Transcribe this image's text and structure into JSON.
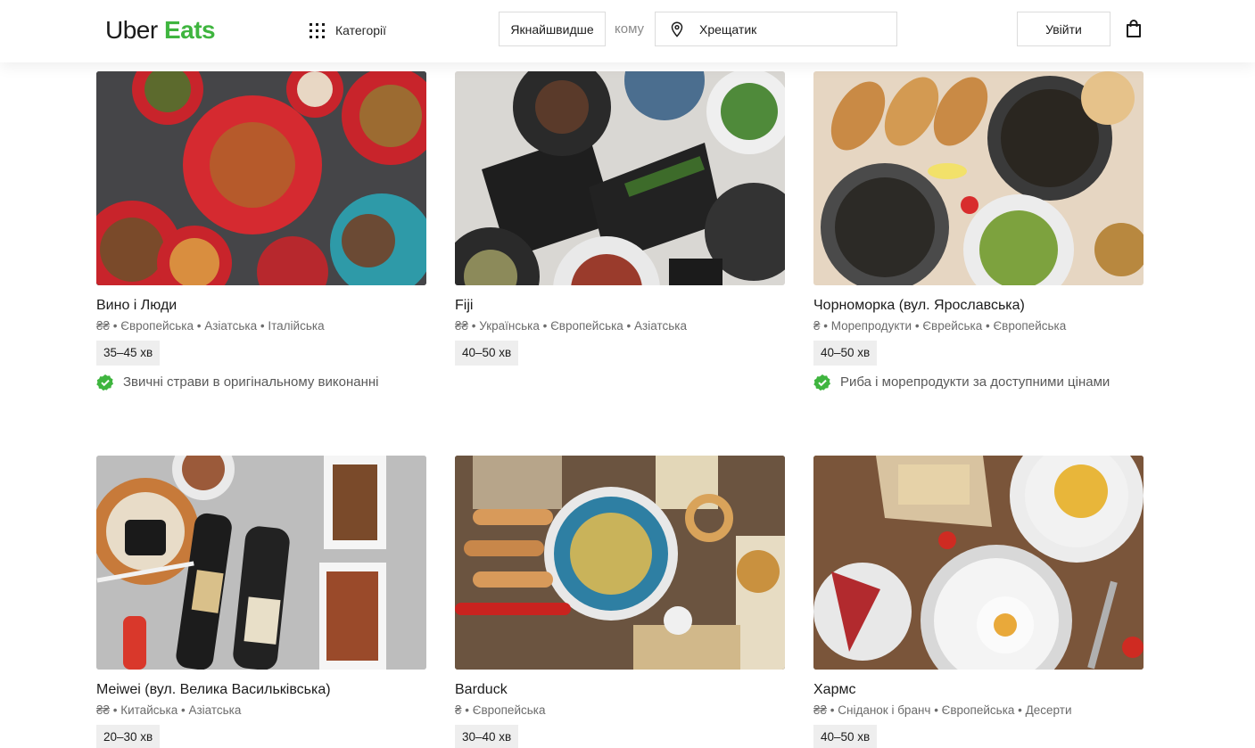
{
  "header": {
    "logo_uber": "Uber",
    "logo_eats": "Eats",
    "categories_label": "Категорії",
    "when_label": "Якнайшвидше",
    "to_label": "кому",
    "address_value": "Хрещатик",
    "login_label": "Увійти",
    "accent_color": "#3fb53f"
  },
  "restaurants": [
    {
      "name": "Вино і Люди",
      "meta": "₴₴ • Європейська • Азіатська • Італійська",
      "eta": "35–45 хв",
      "promo": "Звичні страви в оригінальному виконанні",
      "image_icon": "food-photo"
    },
    {
      "name": "Fiji",
      "meta": "₴₴ • Українська • Європейська • Азіатська",
      "eta": "40–50 хв",
      "promo": "",
      "image_icon": "food-photo"
    },
    {
      "name": "Чорноморка (вул. Ярославська)",
      "meta": "₴ • Морепродукти • Єврейська • Європейська",
      "eta": "40–50 хв",
      "promo": "Риба і морепродукти за доступними цінами",
      "image_icon": "food-photo"
    },
    {
      "name": "Meiwei (вул. Велика Васильківська)",
      "meta": "₴₴ • Китайська • Азіатська",
      "eta": "20–30 хв",
      "promo": "",
      "image_icon": "food-photo"
    },
    {
      "name": "Barduck",
      "meta": "₴ • Європейська",
      "eta": "30–40 хв",
      "promo": "",
      "image_icon": "food-photo"
    },
    {
      "name": "Хармс",
      "meta": "₴₴ • Сніданок і бранч • Європейська • Десерти",
      "eta": "40–50 хв",
      "promo": "",
      "image_icon": "food-photo"
    }
  ]
}
